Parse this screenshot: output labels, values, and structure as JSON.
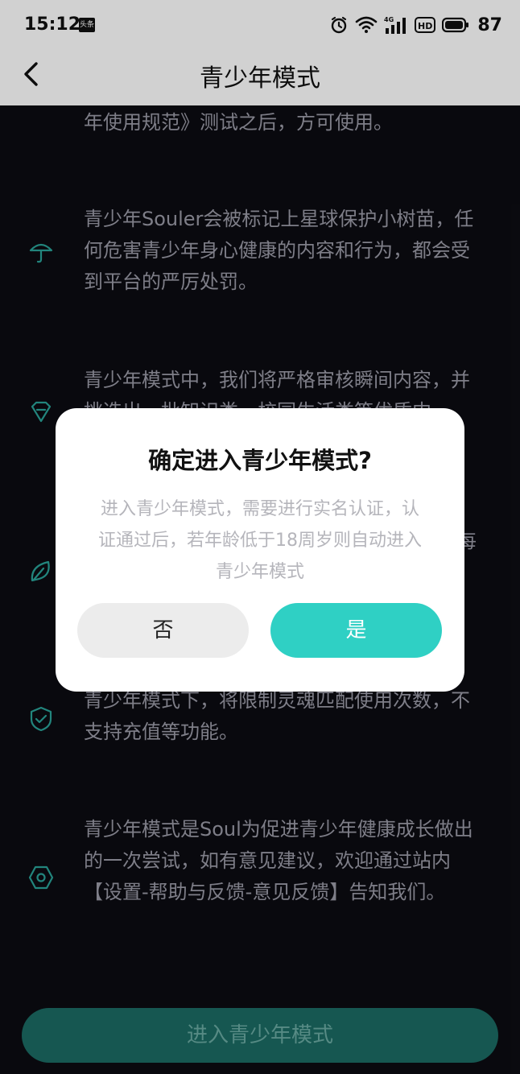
{
  "status_bar": {
    "time": "15:12",
    "app_badge": "头条",
    "battery": "87",
    "icons": [
      "alarm-icon",
      "wifi-icon",
      "signal-4g-icon",
      "hd-icon",
      "battery-icon"
    ]
  },
  "nav": {
    "title": "青少年模式",
    "back_icon": "chevron-left-icon"
  },
  "content": {
    "items": [
      {
        "icon": "none",
        "text": "年使用规范》测试之后，方可使用。"
      },
      {
        "icon": "umbrella-icon",
        "text": "青少年Souler会被标记上星球保护小树苗，任何危害青少年身心健康的内容和行为，都会受到平台的严厉处罚。"
      },
      {
        "icon": "diamond-icon",
        "text": "青少年模式中，我们将严格审核瞬间内容，并挑选出一批知识类、校园生活类等优质内"
      },
      {
        "icon": "leaf-icon",
        "text": "每"
      },
      {
        "icon": "shield-check-icon",
        "text": "青少年模式下，将限制灵魂匹配使用次数，不支持充值等功能。"
      },
      {
        "icon": "hexagon-icon",
        "text": "青少年模式是Soul为促进青少年健康成长做出的一次尝试，如有意见建议，欢迎通过站内【设置-帮助与反馈-意见反馈】告知我们。"
      }
    ],
    "enter_button": "进入青少年模式"
  },
  "dialog": {
    "title": "确定进入青少年模式?",
    "body_lines": [
      "进入青少年模式，需要进行实名认证，认",
      "证通过后，若年龄低于18周岁则自动进入",
      "青少年模式"
    ],
    "cancel": "否",
    "confirm": "是"
  },
  "colors": {
    "accent": "#2fd0c4",
    "background": "#0c0c12",
    "text_muted": "#9a9aa6"
  }
}
